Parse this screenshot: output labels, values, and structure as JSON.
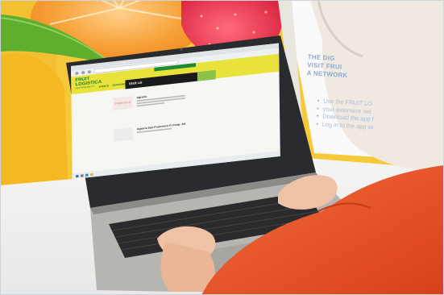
{
  "website": {
    "logo_line1": "FRUIT",
    "logo_line2": "LOGISTICA",
    "logo_sub": "HUB FIRMENBUCH",
    "nav": [
      "EVENTS",
      "BESUCHEN",
      "AUSSTELLEN",
      "PRESSE"
    ],
    "banner_text": "Visit us",
    "cards": [
      {
        "image_label": "Paderland",
        "date": "",
        "title": "Agraria",
        "lines": 3
      },
      {
        "image_label": "",
        "date": "",
        "title": "Agraria San Francesco P. Coop. Arl.",
        "lines": 1
      }
    ]
  },
  "poster": {
    "headline_lines": [
      "THE DIG",
      "VISIT FRUI",
      "A NETWORK"
    ],
    "list_lines": [
      "Use the FRUIT LO",
      "your extensive net",
      "Download the app f",
      "Log in to the app wi"
    ]
  },
  "colors": {
    "site_yellow": "#e9e23a",
    "site_green": "#1f7a2c",
    "sweater_red": "#e8532a",
    "poster_blue": "#8aa9cf"
  }
}
